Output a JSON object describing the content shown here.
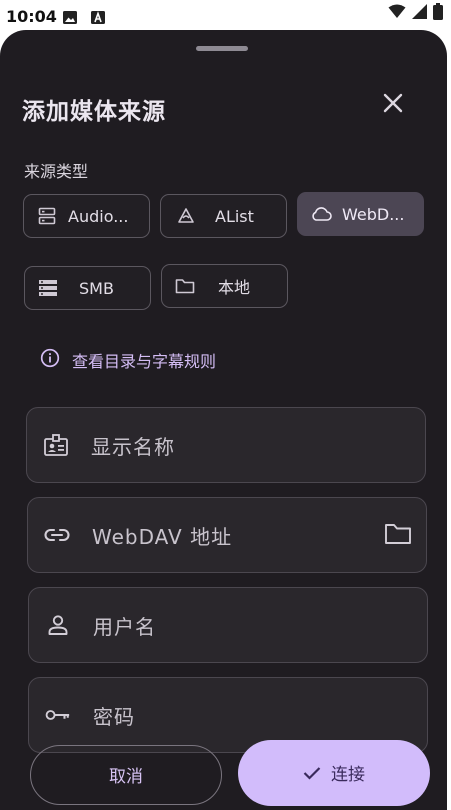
{
  "status_bar": {
    "time": "10:04"
  },
  "sheet": {
    "title": "添加媒体来源",
    "source_type_label": "来源类型",
    "source_types": [
      {
        "label": "Audio...",
        "icon": "server-icon",
        "selected": false
      },
      {
        "label": "AList",
        "icon": "alist-icon",
        "selected": false
      },
      {
        "label": "WebD...",
        "icon": "cloud-icon",
        "selected": true
      },
      {
        "label": "SMB",
        "icon": "storage-icon",
        "selected": false
      },
      {
        "label": "本地",
        "icon": "folder-icon",
        "selected": false
      }
    ],
    "hint_link": "查看目录与字幕规则",
    "fields": {
      "display_name": {
        "placeholder": "显示名称",
        "icon": "badge-icon"
      },
      "webdav_url": {
        "placeholder": "WebDAV 地址",
        "icon": "link-icon",
        "trailing_icon": "folder-icon"
      },
      "username": {
        "placeholder": "用户名",
        "icon": "person-icon"
      },
      "password": {
        "placeholder": "密码",
        "icon": "key-icon"
      }
    },
    "buttons": {
      "cancel": "取消",
      "connect": "连接"
    }
  }
}
